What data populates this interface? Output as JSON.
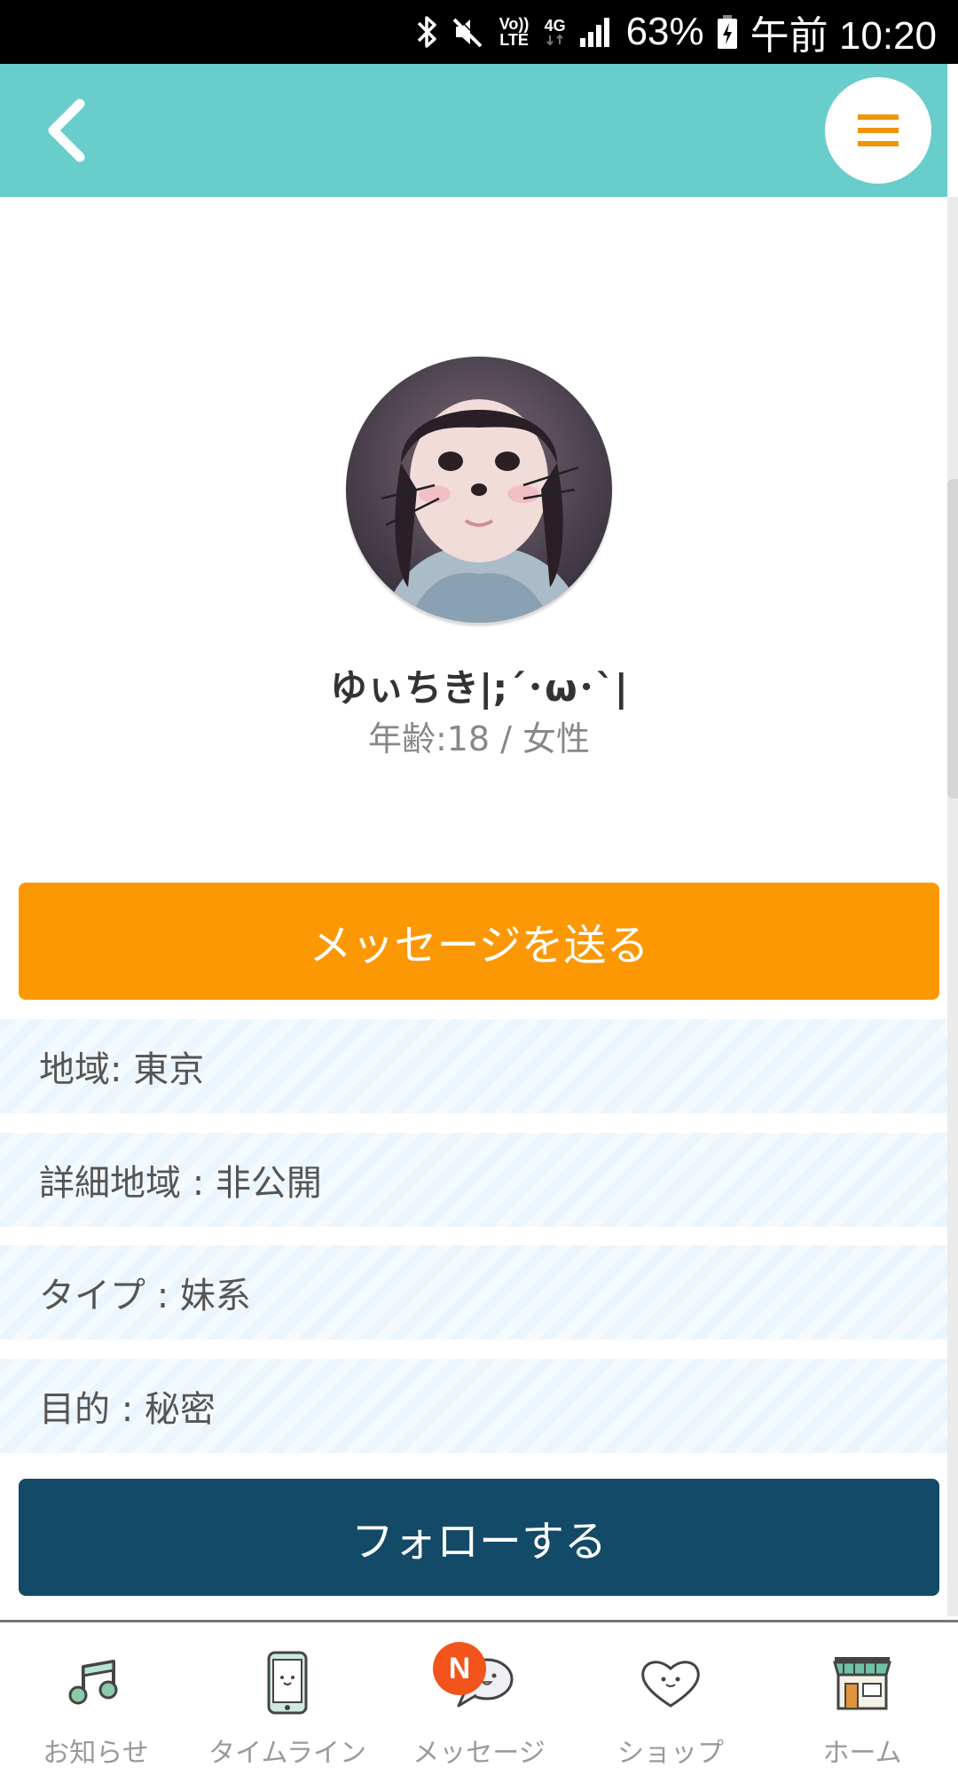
{
  "status_bar": {
    "battery": "63%",
    "time": "午前 10:20",
    "volte_label": "Vo)) LTE",
    "network_label": "4G"
  },
  "header": {
    "back_icon": "chevron-left-icon",
    "menu_icon": "hamburger-menu-icon"
  },
  "profile": {
    "name": "ゆぃちき|;´･ω･`|",
    "age_gender": "年齢:18 / 女性"
  },
  "actions": {
    "message_label": "メッセージを送る",
    "follow_label": "フォローする"
  },
  "info": {
    "region": "地域: 東京",
    "detail_region": "詳細地域 : 非公開",
    "type": "タイプ : 妹系",
    "purpose": "目的 : 秘密"
  },
  "nav": {
    "items": [
      {
        "label": "お知らせ",
        "icon": "music-note-icon"
      },
      {
        "label": "タイムライン",
        "icon": "phone-face-icon"
      },
      {
        "label": "メッセージ",
        "icon": "chat-bubble-icon",
        "badge": "N"
      },
      {
        "label": "ショップ",
        "icon": "heart-face-icon"
      },
      {
        "label": "ホーム",
        "icon": "shop-house-icon"
      }
    ]
  },
  "colors": {
    "header": "#69cdcc",
    "message_button": "#fb9803",
    "follow_button": "#124a67",
    "badge": "#f2541b",
    "row_stripe": "#eaf5fd"
  }
}
